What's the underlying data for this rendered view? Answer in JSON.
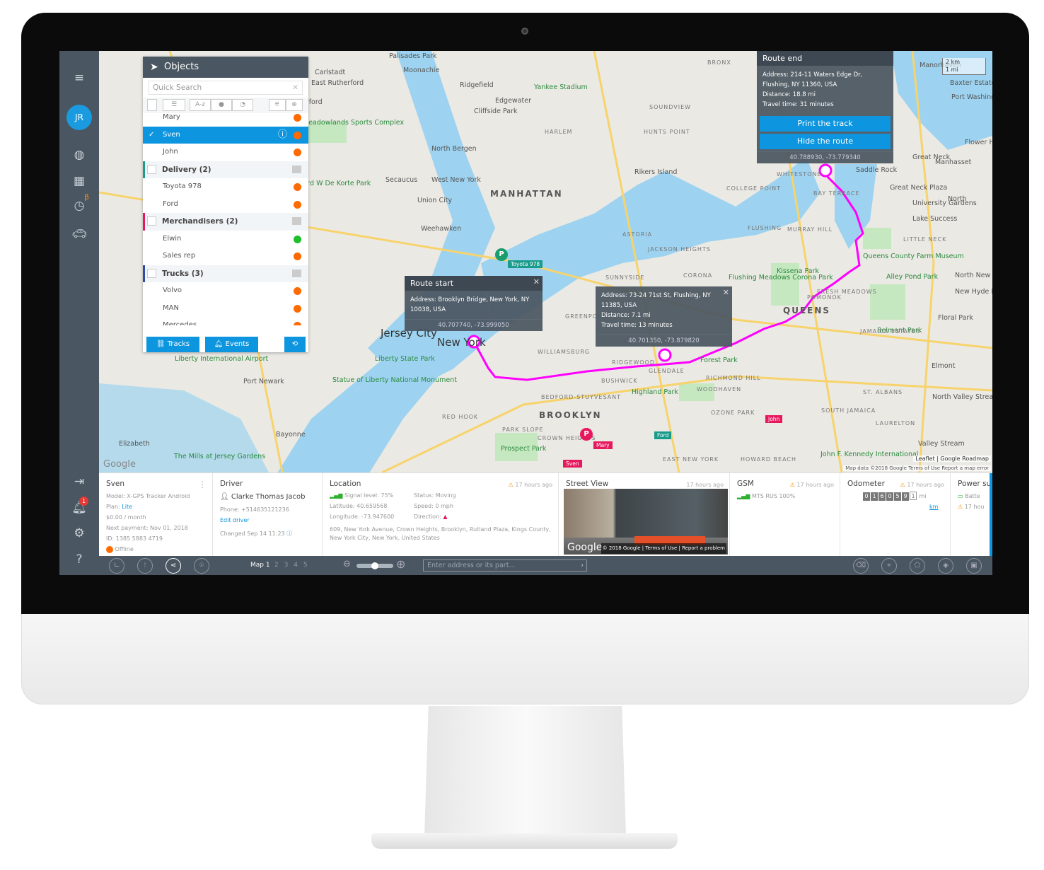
{
  "sidebar": {
    "avatar": "JR",
    "beta": "β",
    "notification_count": "1",
    "items": [
      "menu-icon",
      "globe-icon",
      "chart-icon",
      "clock-pin-icon",
      "car-icon",
      "login-icon",
      "bell-icon",
      "gear-icon",
      "help-icon"
    ]
  },
  "objects": {
    "title": "Objects",
    "search_placeholder": "Quick Search",
    "sort_label": "A-z",
    "rows": [
      {
        "label": "Mary",
        "type": "item",
        "status": "#ff6a00"
      },
      {
        "label": "Sven",
        "type": "item",
        "selected": true,
        "status": "#ff6a00"
      },
      {
        "label": "John",
        "type": "item",
        "status": "#ff6a00"
      },
      {
        "label": "Delivery (2)",
        "type": "group",
        "color": "#1a9c8c"
      },
      {
        "label": "Toyota 978",
        "type": "item",
        "status": "#ff6a00"
      },
      {
        "label": "Ford",
        "type": "item",
        "status": "#ff6a00"
      },
      {
        "label": "Merchandisers (2)",
        "type": "group",
        "color": "#e8185f"
      },
      {
        "label": "Elwin",
        "type": "item",
        "status": "#1fbf2a"
      },
      {
        "label": "Sales rep",
        "type": "item",
        "status": "#ff6a00"
      },
      {
        "label": "Trucks (3)",
        "type": "group",
        "color": "#2d4aa8"
      },
      {
        "label": "Volvo",
        "type": "item",
        "status": "#ff6a00"
      },
      {
        "label": "MAN",
        "type": "item",
        "status": "#ff6a00"
      },
      {
        "label": "Mercedes",
        "type": "item",
        "status": "#ff6a00"
      }
    ],
    "tracks": "Tracks",
    "events": "Events"
  },
  "popups": {
    "start": {
      "title": "Route start",
      "address": "Address: Brooklyn Bridge, New York, NY 10038, USA",
      "coords": "40.707740, -73.999050"
    },
    "mid": {
      "address": "Address: 73-24 71st St, Flushing, NY 11385, USA",
      "distance": "Distance: 7.1 mi",
      "time": "Travel time: 13 minutes",
      "coords": "40.701350, -73.879820"
    },
    "end": {
      "title": "Route end",
      "address": "Address: 214-11 Waters Edge Dr, Flushing, NY 11360, USA",
      "distance": "Distance: 18.8 mi",
      "time": "Travel time: 31 minutes",
      "print": "Print the track",
      "hide": "Hide the route",
      "coords": "40.788930, -73.779340"
    }
  },
  "map": {
    "scale_km": "2 km",
    "scale_mi": "1 mi",
    "attribution": "Leaflet | Google Roadmap",
    "footer": "Map data ©2018 Google   Terms of Use   Report a map error",
    "google": "Google",
    "markers": {
      "toyota": "Toyota 978",
      "ford": "Ford",
      "mary": "Mary",
      "sven": "Sven",
      "john": "John",
      "p": "P"
    },
    "route_color": "#ff00ff",
    "labels": [
      "Palisades Park",
      "Moonachie",
      "Carlstadt",
      "East Rutherford",
      "Rutherford",
      "Ridgefield",
      "Edgewater",
      "Cliffside Park",
      "Yankee Stadium",
      "HARLEM",
      "Meadowlands Sports Complex",
      "North Bergen",
      "Secaucus",
      "West New York",
      "Union City",
      "MANHATTAN",
      "Weehawken",
      "Jersey City",
      "New York",
      "Liberty State Park",
      "Statue of Liberty National Monument",
      "Port Newark",
      "Bayonne",
      "Elizabeth",
      "BROOKLYN",
      "QUEENS",
      "Rikers Island",
      "ASTORIA",
      "Flushing Meadows Corona Park",
      "Kissena Park",
      "Highland Park",
      "Prospect Park",
      "Forest Park",
      "Belmont Park",
      "Elmont",
      "Valley Stream",
      "North Valley Stream",
      "Floral Park",
      "Great Neck",
      "Manhasset",
      "Port Washington",
      "Baxter Estates",
      "Manorhaven",
      "Flower Hill",
      "Saddle Rock",
      "University Gardens",
      "Lake Success",
      "Queens County Farm Museum",
      "Alley Pond Park",
      "New Hyde Park",
      "North New Hyde Park",
      "John F. Kennedy International",
      "GREENPOINT",
      "WILLIAMSBURG",
      "BUSHWICK",
      "RIDGEWOOD",
      "GLENDALE",
      "CROWN HEIGHTS",
      "PARK SLOPE",
      "RED HOOK",
      "CORONA",
      "SUNNYSIDE",
      "JACKSON HEIGHTS",
      "HUNTS POINT",
      "SOUNDVIEW",
      "BRONX",
      "MURRAY HILL",
      "JAMAICA ESTATES",
      "ST. ALBANS",
      "OZONE PARK",
      "HOWARD BEACH",
      "EAST NEW YORK",
      "BEDFORD-STUYVESANT",
      "RICHMOND HILL",
      "WOODHAVEN",
      "LAURELTON",
      "SOUTH JAMAICA",
      "COLLEGE POINT",
      "WHITESTONE",
      "BAY TERRACE",
      "LITTLE NECK",
      "FLUSHING",
      "POMONOK",
      "FRESH MEADOWS",
      "Richard W De Korte Park",
      "Liberty International Airport",
      "The Mills at Jersey Gardens",
      "Great Neck Plaza",
      "North"
    ]
  },
  "info": {
    "device": {
      "name": "Sven",
      "model": "Model: X-GPS Tracker Android",
      "plan_label": "Plan: ",
      "plan": "Lite",
      "price": "$0.00 / month",
      "next_payment": "Next payment: Nov 01, 2018",
      "id": "ID: 1385 5883 4719",
      "status": "Offline"
    },
    "driver": {
      "title": "Driver",
      "name": "Clarke Thomas Jacob",
      "phone": "Phone: +514635121236",
      "edit": "Edit driver",
      "changed": "Changed Sep 14 11:23"
    },
    "location": {
      "title": "Location",
      "ago": "17 hours ago",
      "signal": "Signal level: 75%",
      "latitude": "Latitude: 40.659568",
      "longitude": "Longitude: -73.947600",
      "status": "Status: Moving",
      "speed": "Speed: 0 mph",
      "direction": "Direction:",
      "address": "609, New York Avenue, Crown Heights, Brooklyn, Rutland Plaza, Kings County, New York City, New York, United States"
    },
    "street": {
      "title": "Street View",
      "ago": "17 hours ago",
      "google": "Google",
      "copyright": "© 2018 Google",
      "terms": "Terms of Use",
      "report": "Report a problem"
    },
    "gsm": {
      "title": "GSM",
      "ago": "17 hours ago",
      "operator": "MTS RUS 100%"
    },
    "odometer": {
      "title": "Odometer",
      "ago": "17 hours ago",
      "digits": [
        "0",
        "1",
        "6",
        "0",
        "5",
        "9",
        "1"
      ],
      "unit": "mi",
      "alt_unit": "km"
    },
    "power": {
      "title": "Power su",
      "battery": "Batte",
      "ago": "17 hou"
    }
  },
  "toolbar": {
    "map_label": "Map 1",
    "maps": [
      "2",
      "3",
      "4",
      "5"
    ],
    "zoom_level": 0.5,
    "address_placeholder": "Enter address or its part..."
  }
}
